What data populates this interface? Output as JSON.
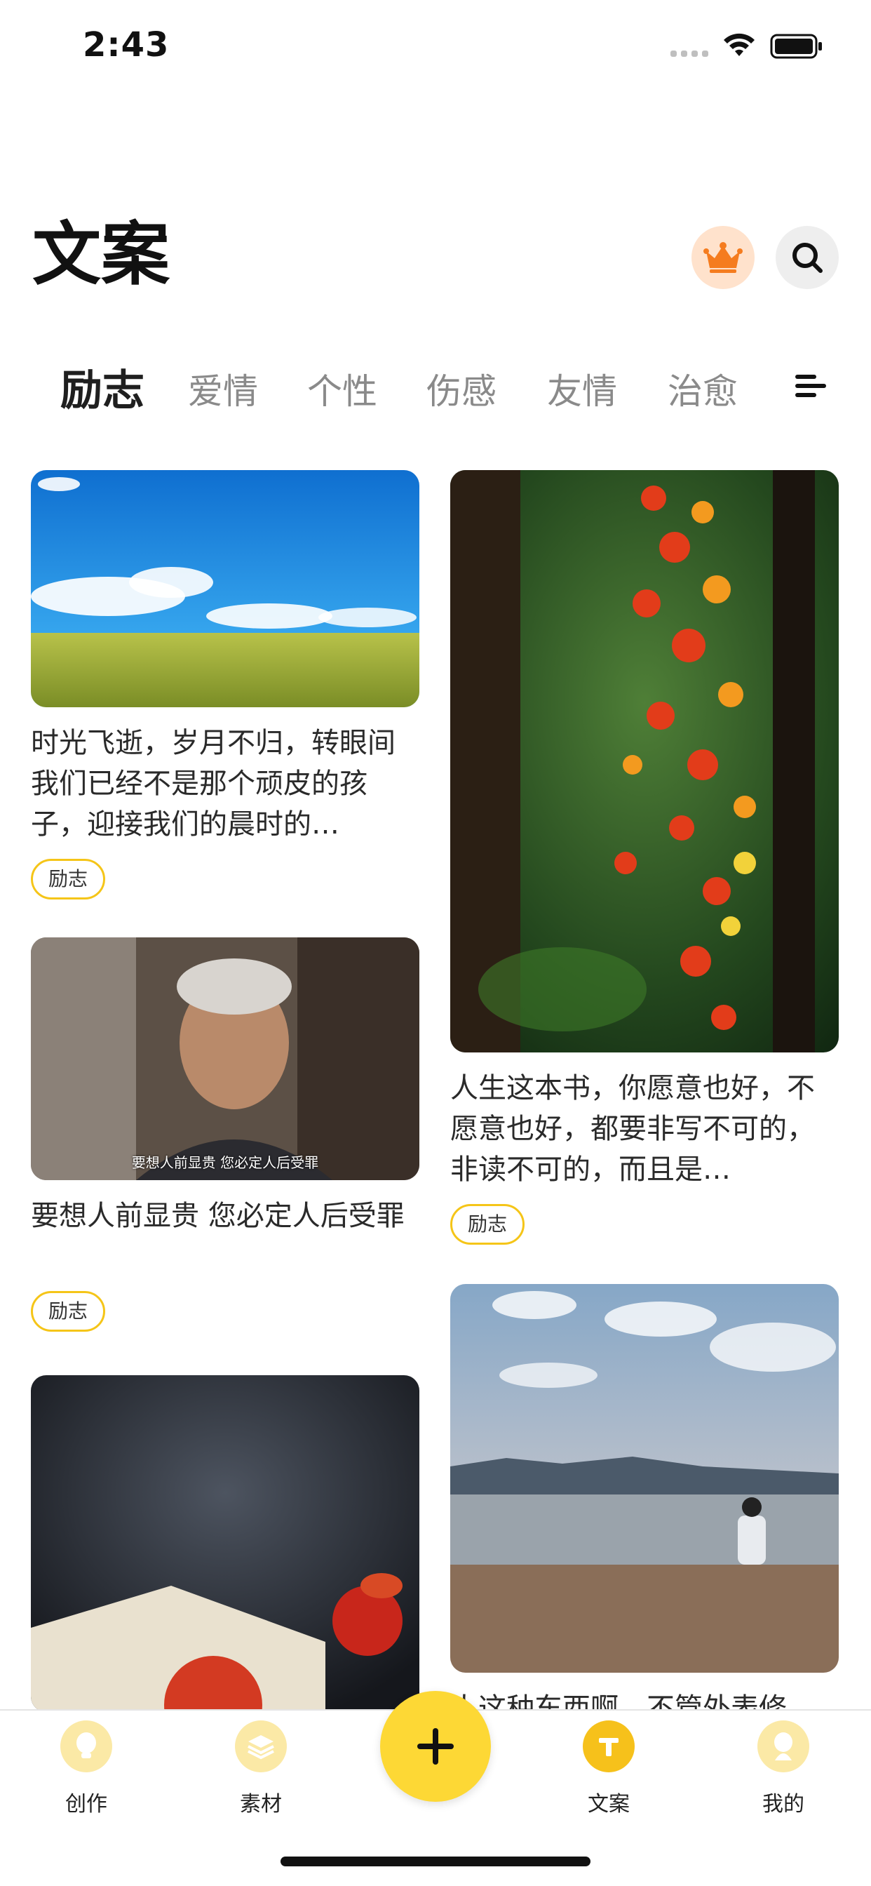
{
  "status_bar": {
    "time": "2:43"
  },
  "header": {
    "title": "文案"
  },
  "tabs": [
    {
      "label": "励志"
    },
    {
      "label": "爱情"
    },
    {
      "label": "个性"
    },
    {
      "label": "伤感"
    },
    {
      "label": "友情"
    },
    {
      "label": "治愈"
    }
  ],
  "cards": [
    {
      "text": "时光飞逝，岁月不归，转眼间我们已经不是那个顽皮的孩子，迎接我们的晨时的…",
      "tag": "励志"
    },
    {
      "text": "人生这本书，你愿意也好，不愿意也好，都要非写不可的，非读不可的，而且是…",
      "tag": "励志"
    },
    {
      "text": "要想人前显贵 您必定人后受罪",
      "tag": "励志",
      "image_caption": "要想人前显贵  您必定人后受罪"
    },
    {
      "text": "人这种东西啊，不管外表修"
    },
    {
      "text": ""
    }
  ],
  "bottom_nav": [
    {
      "label": "创作",
      "icon": "bulb-icon"
    },
    {
      "label": "素材",
      "icon": "layers-icon"
    },
    {
      "label": "文案",
      "icon": "text-t-icon"
    },
    {
      "label": "我的",
      "icon": "profile-icon"
    }
  ],
  "colors": {
    "accent": "#F6C11B",
    "fab": "#FDD835",
    "tag_border": "#F5C518"
  }
}
